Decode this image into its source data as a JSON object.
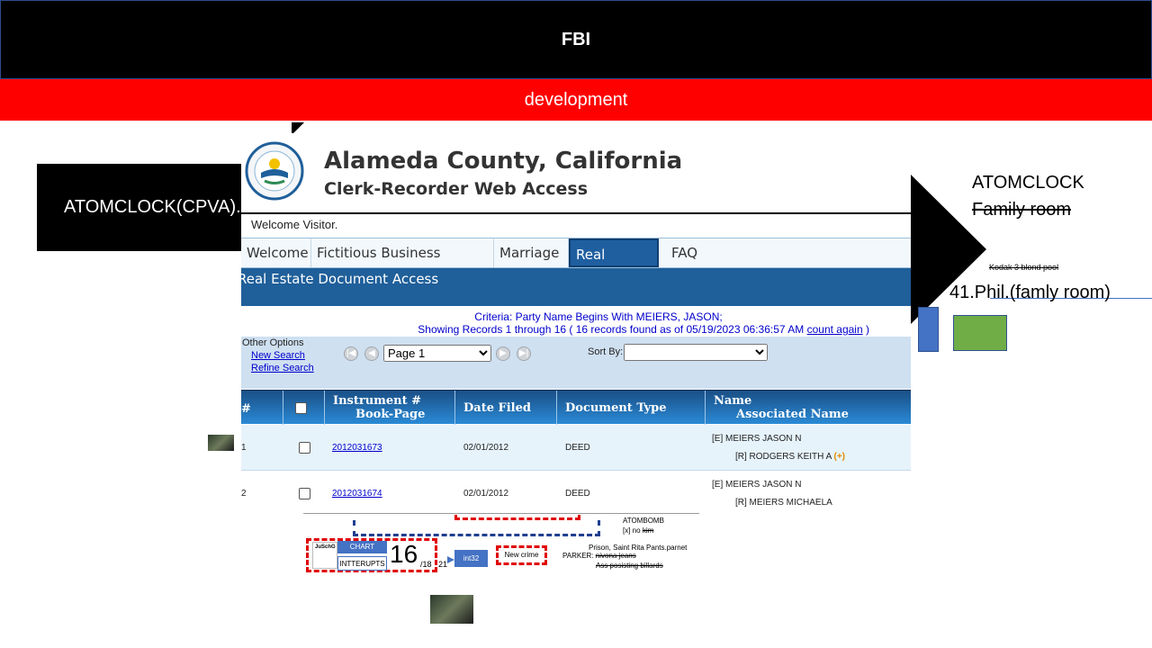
{
  "banner": {
    "title": "FBI",
    "subtitle": "development"
  },
  "left_box": {
    "text": "ATOMCLOCK(CPVA).s"
  },
  "right_notes": {
    "atomclock": "ATOMCLOCK",
    "family_room": "Family room",
    "kodak": "Kodak 3 blond pool",
    "phil": "41.Phil.(famly room)"
  },
  "clerk": {
    "title": "Alameda County, California",
    "subtitle": "Clerk-Recorder Web Access",
    "seal_text": "ALAMEDA COUNTY",
    "welcome": "Welcome Visitor.",
    "nav": [
      "Welcome",
      "Fictitious Business Names",
      "Marriage",
      "Real Estate",
      "FAQ"
    ],
    "active_nav": "Real Estate",
    "section_title": "Real Estate Document Access",
    "criteria": "Criteria:  Party Name Begins With MEIERS, JASON;",
    "showing_prefix": "Showing Records 1 through 16 ( 16 records found as of 05/19/2023 06:36:57 AM ",
    "count_again": "count again",
    "showing_suffix": " )",
    "other_options": "Other Options",
    "new_search": "New Search",
    "refine_search": "Refine Search",
    "page_select": "Page 1",
    "sort_by": "Sort By:",
    "columns": {
      "num": "#",
      "instrument": "Instrument #",
      "book_page": "Book-Page",
      "date_filed": "Date Filed",
      "doc_type": "Document Type",
      "name": "Name",
      "assoc": "Associated Name"
    },
    "rows": [
      {
        "num": "1",
        "instrument": "2012031673",
        "date": "02/01/2012",
        "type": "DEED",
        "name": "[E]  MEIERS JASON N",
        "assoc": "[R]  RODGERS KEITH A",
        "more": "(+)"
      },
      {
        "num": "2",
        "instrument": "2012031674",
        "date": "02/01/2012",
        "type": "DEED",
        "name": "[E]  MEIERS JASON N",
        "assoc": "[R]  MEIERS MICHAELA",
        "more": ""
      }
    ]
  },
  "collage": {
    "jusch": "JuSchG",
    "chart": "CHART",
    "interrupts": "INTTERUPTS",
    "big_num": "16",
    "frac": "/18",
    "num21": "21",
    "int32": "int32",
    "new_crime": "New crime",
    "atombomb": "ATOMBOMB",
    "x_no": "[x] no",
    "kim": "kim",
    "prison": "Prison, Saint Rita Pants.parnet",
    "parker": "PARKER:",
    "nivona": "nivona jeans",
    "ass": "Ass posisting billards"
  }
}
